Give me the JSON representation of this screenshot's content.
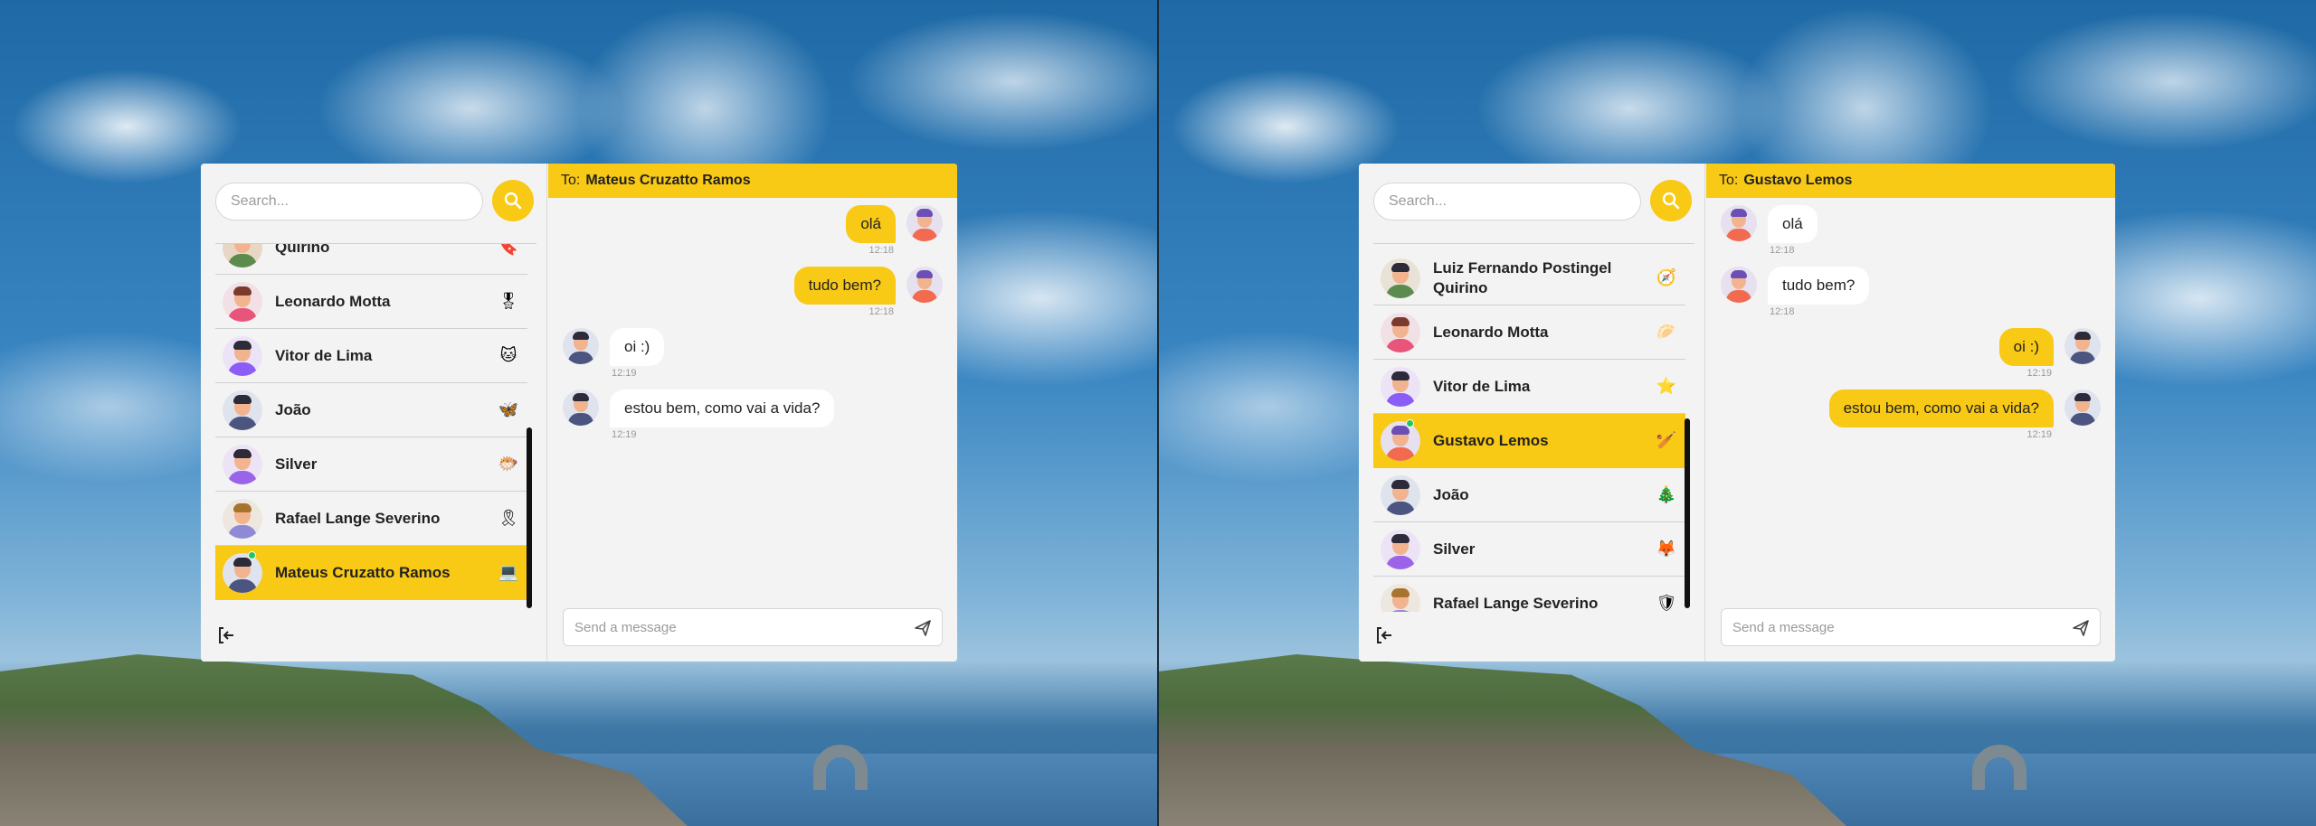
{
  "search": {
    "placeholder": "Search..."
  },
  "composer": {
    "placeholder": "Send a message"
  },
  "colors": {
    "accent": "#f8c915",
    "online": "#22c55e",
    "panel": "#f3f3f3"
  },
  "icons": {
    "search": "search-icon",
    "logout": "logout-icon",
    "send": "send-icon"
  },
  "left_window": {
    "header": {
      "to_label": "To:",
      "to_name": "Mateus Cruzatto Ramos"
    },
    "contacts": [
      {
        "name": "Quirino",
        "emoji": "🔖"
      },
      {
        "name": "Leonardo Motta",
        "emoji": "🎖"
      },
      {
        "name": "Vitor de Lima",
        "emoji": "🐱"
      },
      {
        "name": "João",
        "emoji": "🦋"
      },
      {
        "name": "Silver",
        "emoji": "🐡"
      },
      {
        "name": "Rafael Lange Severino",
        "emoji": "🎗"
      },
      {
        "name": "Mateus Cruzatto Ramos",
        "emoji": "💻"
      }
    ],
    "messages": [
      {
        "text": "olá",
        "time": "12:18"
      },
      {
        "text": "tudo bem?",
        "time": "12:18"
      },
      {
        "text": "oi :)",
        "time": "12:19"
      },
      {
        "text": "estou bem, como vai a vida?",
        "time": "12:19"
      }
    ]
  },
  "right_window": {
    "header": {
      "to_label": "To:",
      "to_name": "Gustavo Lemos"
    },
    "contacts": [
      {
        "name": "Luiz Fernando Postingel Quirino",
        "emoji": "🧭"
      },
      {
        "name": "Leonardo Motta",
        "emoji": "🥟"
      },
      {
        "name": "Vitor de Lima",
        "emoji": "⭐"
      },
      {
        "name": "Gustavo Lemos",
        "emoji": "🏏"
      },
      {
        "name": "João",
        "emoji": "🎄"
      },
      {
        "name": "Silver",
        "emoji": "🦊"
      },
      {
        "name": "Rafael Lange Severino",
        "emoji": "🛡"
      }
    ],
    "messages": [
      {
        "text": "olá",
        "time": "12:18"
      },
      {
        "text": "tudo bem?",
        "time": "12:18"
      },
      {
        "text": "oi :)",
        "time": "12:19"
      },
      {
        "text": "estou bem, como vai a vida?",
        "time": "12:19"
      }
    ]
  }
}
